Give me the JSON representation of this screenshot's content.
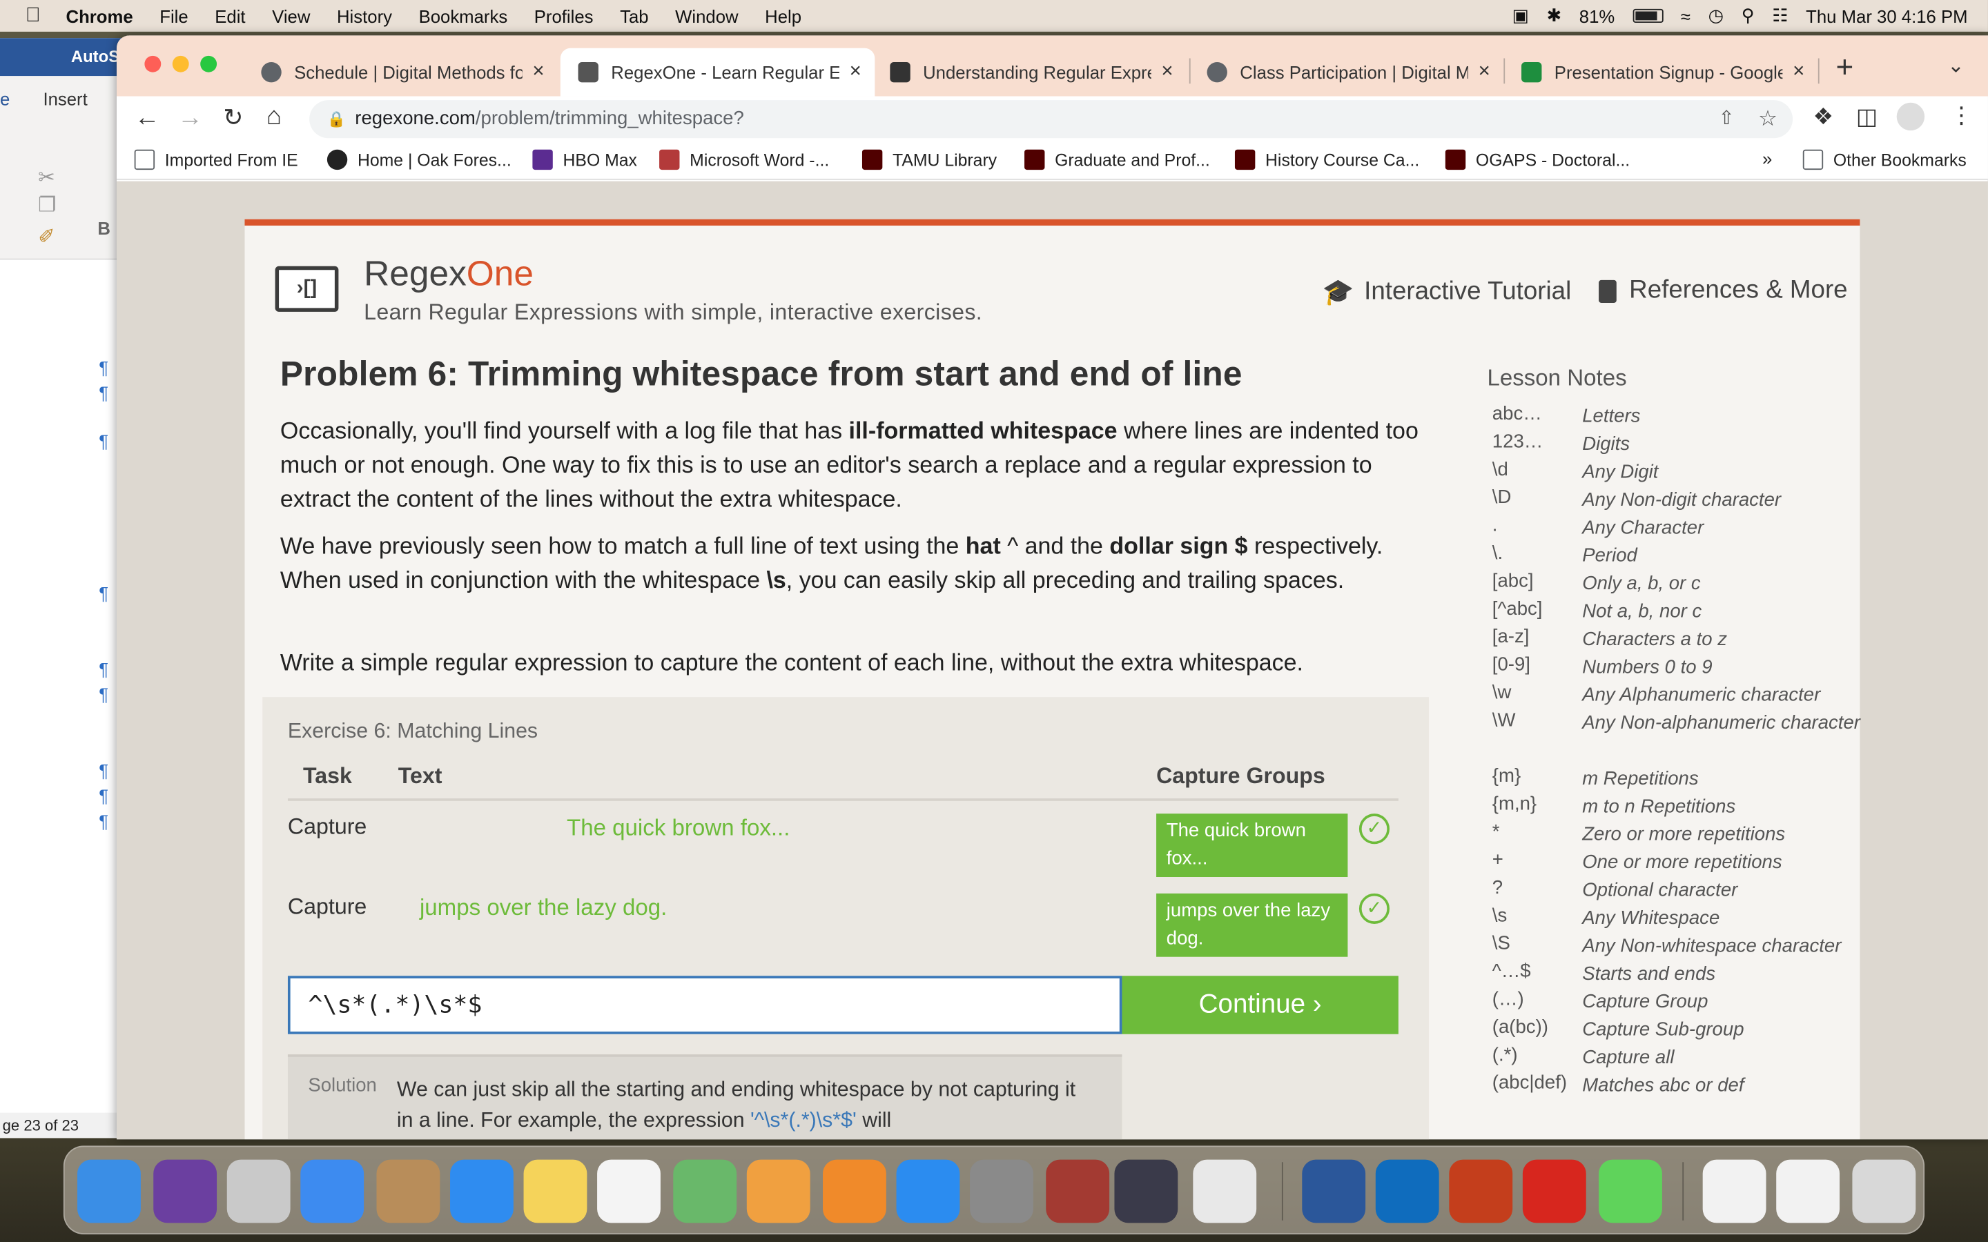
{
  "menubar": {
    "app": "Chrome",
    "items": [
      "File",
      "Edit",
      "View",
      "History",
      "Bookmarks",
      "Profiles",
      "Tab",
      "Window",
      "Help"
    ],
    "battery": "81%",
    "datetime": "Thu Mar 30  4:16 PM"
  },
  "word": {
    "title": "AutoS",
    "tab_partial": "e",
    "tab_insert": "Insert",
    "status": "ge 23 of 23"
  },
  "tabs": [
    {
      "title": "Schedule | Digital Methods fo",
      "color": "#5f6368"
    },
    {
      "title": "RegexOne - Learn Regular Ex",
      "color": "#555555"
    },
    {
      "title": "Understanding Regular Expre",
      "color": "#333333"
    },
    {
      "title": "Class Participation | Digital M",
      "color": "#5f6368"
    },
    {
      "title": "Presentation Signup - Google",
      "color": "#1e8e3e"
    }
  ],
  "address": {
    "host": "regexone.com",
    "path": "/problem/trimming_whitespace?"
  },
  "bookmarks": [
    {
      "label": "Imported From IE",
      "color": "#5f6368"
    },
    {
      "label": "Home | Oak Fores...",
      "color": "#222222"
    },
    {
      "label": "HBO Max",
      "color": "#5b2c91"
    },
    {
      "label": "Microsoft Word -...",
      "color": "#b33a3a"
    },
    {
      "label": "TAMU Library",
      "color": "#500000"
    },
    {
      "label": "Graduate and Prof...",
      "color": "#500000"
    },
    {
      "label": "History Course Ca...",
      "color": "#500000"
    },
    {
      "label": "OGAPS - Doctoral...",
      "color": "#500000"
    }
  ],
  "other_bookmarks": "Other Bookmarks",
  "site": {
    "brand_a": "Regex",
    "brand_b": "One",
    "tagline": "Learn Regular Expressions with simple, interactive exercises.",
    "nav_tutorial": "Interactive Tutorial",
    "nav_refs": "References & More"
  },
  "problem": {
    "title": "Problem 6: Trimming whitespace from start and end of line",
    "p1a": "Occasionally, you'll find yourself with a log file that has ",
    "p1b": "ill-formatted whitespace",
    "p1c": " where lines are indented too much or not enough. One way to fix this is to use an editor's search a replace and a regular expression to extract the content of the lines without the extra whitespace.",
    "p2a": "We have previously seen how to match a full line of text using the ",
    "p2b": "hat",
    "p2c": " ^ and the ",
    "p2d": "dollar sign $",
    "p2e": " respectively. When used in conjunction with the whitespace ",
    "p2f": "\\s",
    "p2g": ", you can easily skip all preceding and trailing spaces.",
    "p3": "Write a simple regular expression to capture the content of each line, without the extra whitespace."
  },
  "exercise": {
    "label": "Exercise 6: Matching Lines",
    "col_task": "Task",
    "col_text": "Text",
    "col_groups": "Capture Groups",
    "rows": [
      {
        "task": "Capture",
        "text": "The quick brown fox...",
        "group": "The quick brown fox..."
      },
      {
        "task": "Capture",
        "text": "jumps over the lazy dog.",
        "group": "jumps over the lazy dog."
      }
    ],
    "input_value": "^\\s*(.*)\\s*$",
    "continue": "Continue ›",
    "solution_label": "Solution",
    "solution_a": "We can just skip all the starting and ending whitespace by not capturing it in a line. For example, the expression ",
    "solution_code": "'^\\s*(.*)\\s*$'",
    "solution_b": " will"
  },
  "notes": {
    "title": "Lesson Notes",
    "items": [
      {
        "k": "abc…",
        "v": "Letters"
      },
      {
        "k": "123…",
        "v": "Digits"
      },
      {
        "k": "\\d",
        "v": "Any Digit"
      },
      {
        "k": "\\D",
        "v": "Any Non-digit character"
      },
      {
        "k": ".",
        "v": "Any Character"
      },
      {
        "k": "\\.",
        "v": "Period"
      },
      {
        "k": "[abc]",
        "v": "Only a, b, or c"
      },
      {
        "k": "[^abc]",
        "v": "Not a, b, nor c"
      },
      {
        "k": "[a-z]",
        "v": "Characters a to z"
      },
      {
        "k": "[0-9]",
        "v": "Numbers 0 to 9"
      },
      {
        "k": "\\w",
        "v": "Any Alphanumeric character"
      },
      {
        "k": "\\W",
        "v": "Any Non-alphanumeric character"
      },
      {
        "k": "{m}",
        "v": "m Repetitions"
      },
      {
        "k": "{m,n}",
        "v": "m to n Repetitions"
      },
      {
        "k": "*",
        "v": "Zero or more repetitions"
      },
      {
        "k": "+",
        "v": "One or more repetitions"
      },
      {
        "k": "?",
        "v": "Optional character"
      },
      {
        "k": "\\s",
        "v": "Any Whitespace"
      },
      {
        "k": "\\S",
        "v": "Any Non-whitespace character"
      },
      {
        "k": "^…$",
        "v": "Starts and ends"
      },
      {
        "k": "(…)",
        "v": "Capture Group"
      },
      {
        "k": "(a(bc))",
        "v": "Capture Sub-group"
      },
      {
        "k": "(.*)",
        "v": "Capture all"
      },
      {
        "k": "(abc|def)",
        "v": "Matches abc or def"
      }
    ]
  },
  "dock": [
    {
      "name": "finder-icon",
      "color": "#3a8ee6"
    },
    {
      "name": "siri-icon",
      "color": "#6b3fa0"
    },
    {
      "name": "launchpad-icon",
      "color": "#c9c9c9"
    },
    {
      "name": "mail-icon",
      "color": "#3d8bf0"
    },
    {
      "name": "contacts-icon",
      "color": "#b88d5a"
    },
    {
      "name": "safari-icon",
      "color": "#2f8cf0"
    },
    {
      "name": "notes-icon",
      "color": "#f5d35a"
    },
    {
      "name": "reminders-icon",
      "color": "#f4f4f4"
    },
    {
      "name": "maps-icon",
      "color": "#69b86a"
    },
    {
      "name": "photos-icon",
      "color": "#f0a040"
    },
    {
      "name": "books-icon",
      "color": "#f08a2a"
    },
    {
      "name": "app-store-icon",
      "color": "#2b8cf0"
    },
    {
      "name": "system-preferences-icon",
      "color": "#8a8a8a"
    },
    {
      "name": "dictionary-icon",
      "color": "#a33a32"
    },
    {
      "name": "medieval-game-icon",
      "color": "#3a3a4a"
    },
    {
      "name": "chrome-icon",
      "color": "#e8e8e8"
    },
    {
      "name": "word-icon",
      "color": "#2b579a"
    },
    {
      "name": "outlook-icon",
      "color": "#0f6cbd"
    },
    {
      "name": "powerpoint-icon",
      "color": "#c43e1c"
    },
    {
      "name": "acrobat-icon",
      "color": "#d7261e"
    },
    {
      "name": "messages-icon",
      "color": "#5fd35b"
    },
    {
      "name": "document-preview-1-icon",
      "color": "#f2f2f2"
    },
    {
      "name": "document-preview-2-icon",
      "color": "#f2f2f2"
    },
    {
      "name": "trash-icon",
      "color": "#d8d8d8"
    }
  ]
}
